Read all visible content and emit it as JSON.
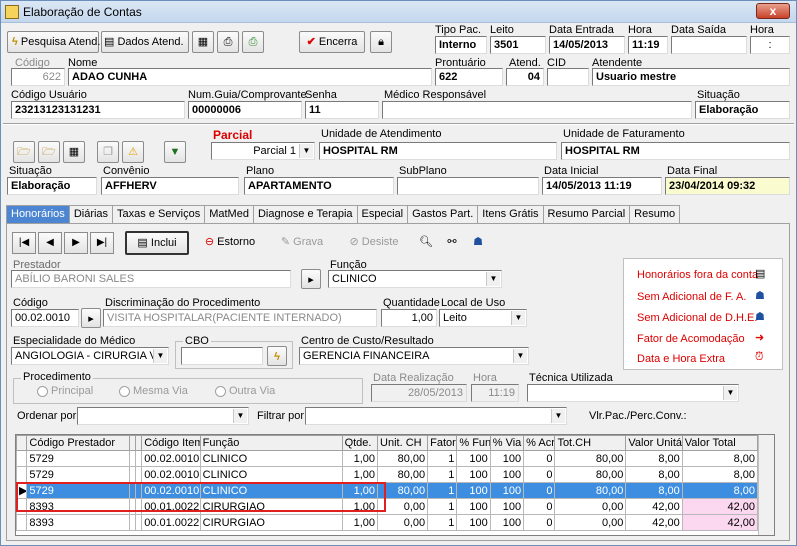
{
  "window": {
    "title": "Elaboração de Contas",
    "close": "x"
  },
  "toolbar": {
    "pesquisa": "Pesquisa Atend.",
    "dados": "Dados Atend.",
    "encerra": "Encerra"
  },
  "header": {
    "tipo_pac": {
      "label": "Tipo Pac.",
      "value": "Interno"
    },
    "leito": {
      "label": "Leito",
      "value": "3501"
    },
    "data_entrada": {
      "label": "Data Entrada",
      "value": "14/05/2013"
    },
    "hora": {
      "label": "Hora",
      "value": "11:19"
    },
    "data_saida": {
      "label": "Data Saída",
      "value": ""
    },
    "hora2": {
      "label": "Hora",
      "value": ":"
    },
    "codigo": {
      "label": "Código",
      "value": "622"
    },
    "nome": {
      "label": "Nome",
      "value": "ADAO CUNHA"
    },
    "prontuario": {
      "label": "Prontuário",
      "value": "622"
    },
    "atend": {
      "label": "Atend.",
      "value": "04"
    },
    "cid": {
      "label": "CID",
      "value": ""
    },
    "atendente": {
      "label": "Atendente",
      "value": "Usuario mestre"
    },
    "codigo_usuario": {
      "label": "Código Usuário",
      "value": "23213123131231"
    },
    "num_guia": {
      "label": "Num.Guia/Comprovante",
      "value": "00000006"
    },
    "senha": {
      "label": "Senha",
      "value": "11"
    },
    "medico": {
      "label": "Médico Responsável",
      "value": ""
    },
    "situacao": {
      "label": "Situação",
      "value": "Elaboração"
    }
  },
  "conta": {
    "parcial_label": "Parcial",
    "parcial_value": "Parcial 1",
    "unidade_atendimento": {
      "label": "Unidade de Atendimento",
      "value": "HOSPITAL RM"
    },
    "unidade_faturamento": {
      "label": "Unidade de Faturamento",
      "value": "HOSPITAL RM"
    },
    "situacao": {
      "label": "Situação",
      "value": "Elaboração"
    },
    "convenio": {
      "label": "Convênio",
      "value": "AFFHERV"
    },
    "plano": {
      "label": "Plano",
      "value": "APARTAMENTO"
    },
    "subplano": {
      "label": "SubPlano",
      "value": ""
    },
    "data_inicial": {
      "label": "Data Inicial",
      "value": "14/05/2013 11:19"
    },
    "data_final": {
      "label": "Data Final",
      "value": "23/04/2014 09:32"
    }
  },
  "tabs": [
    "Honorários",
    "Diárias",
    "Taxas e Serviços",
    "MatMed",
    "Diagnose e Terapia",
    "Especial",
    "Gastos Part.",
    "Itens Grátis",
    "Resumo Parcial",
    "Resumo"
  ],
  "actions": {
    "inclui": "Inclui",
    "estorno": "Estorno",
    "grava": "Grava",
    "desiste": "Desiste"
  },
  "form": {
    "prestador": {
      "label": "Prestador",
      "value": "ABÍLIO BARONI SALES"
    },
    "funcao": {
      "label": "Função",
      "value": "CLINICO"
    },
    "codigo": {
      "label": "Código",
      "value": "00.02.0010"
    },
    "discriminacao": {
      "label": "Discriminação do Procedimento",
      "value": "VISITA HOSPITALAR(PACIENTE INTERNADO)"
    },
    "quantidade": {
      "label": "Quantidade",
      "value": "1,00"
    },
    "local_uso": {
      "label": "Local de Uso",
      "value": "Leito"
    },
    "especialidade": {
      "label": "Especialidade do Médico",
      "value": "ANGIOLOGIA - CIRURGIA VA"
    },
    "cbo": {
      "label": "CBO",
      "value": ""
    },
    "centro_custo": {
      "label": "Centro de Custo/Resultado",
      "value": "GERENCIA FINANCEIRA"
    },
    "procedimento": {
      "label": "Procedimento",
      "options": [
        "Principal",
        "Mesma Via",
        "Outra Via"
      ]
    },
    "data_realizacao": {
      "label": "Data Realização",
      "value": "28/05/2013"
    },
    "hora": {
      "label": "Hora",
      "value": "11:19"
    },
    "tecnica": {
      "label": "Técnica Utilizada",
      "value": ""
    },
    "ordenar": {
      "label": "Ordenar por",
      "value": ""
    },
    "filtrar": {
      "label": "Filtrar por",
      "value": ""
    },
    "vlr_label": "Vlr.Pac./Perc.Conv.:"
  },
  "side_links": [
    "Honorários fora da conta",
    "Sem Adicional de F. A.",
    "Sem Adicional de D.H.E.",
    "Fator de Acomodação",
    "Data e Hora Extra"
  ],
  "grid": {
    "columns": [
      "Código Prestador",
      "Código Item",
      "Função",
      "Qtde.",
      "Unit. CH",
      "Fator",
      "% Fun",
      "% Via",
      "% Acr",
      "Tot.CH",
      "Valor Unitário",
      "Valor Total"
    ],
    "rows": [
      {
        "prestador": "5729",
        "item": "00.02.0010",
        "funcao": "CLINICO",
        "qtde": "1,00",
        "unit": "80,00",
        "fator": "1",
        "fun": "100",
        "via": "100",
        "acr": "0",
        "totch": "80,00",
        "vunit": "8,00",
        "vtotal": "8,00"
      },
      {
        "prestador": "5729",
        "item": "00.02.0010",
        "funcao": "CLINICO",
        "qtde": "1,00",
        "unit": "80,00",
        "fator": "1",
        "fun": "100",
        "via": "100",
        "acr": "0",
        "totch": "80,00",
        "vunit": "8,00",
        "vtotal": "8,00"
      },
      {
        "prestador": "5729",
        "item": "00.02.0010",
        "funcao": "CLINICO",
        "qtde": "1,00",
        "unit": "80,00",
        "fator": "1",
        "fun": "100",
        "via": "100",
        "acr": "0",
        "totch": "80,00",
        "vunit": "8,00",
        "vtotal": "8,00"
      },
      {
        "prestador": "8393",
        "item": "00.01.0022",
        "funcao": "CIRURGIAO",
        "qtde": "1,00",
        "unit": "0,00",
        "fator": "1",
        "fun": "100",
        "via": "100",
        "acr": "0",
        "totch": "0,00",
        "vunit": "42,00",
        "vtotal": "42,00"
      },
      {
        "prestador": "8393",
        "item": "00.01.0022",
        "funcao": "CIRURGIAO",
        "qtde": "1,00",
        "unit": "0,00",
        "fator": "1",
        "fun": "100",
        "via": "100",
        "acr": "0",
        "totch": "0,00",
        "vunit": "42,00",
        "vtotal": "42,00"
      }
    ]
  }
}
